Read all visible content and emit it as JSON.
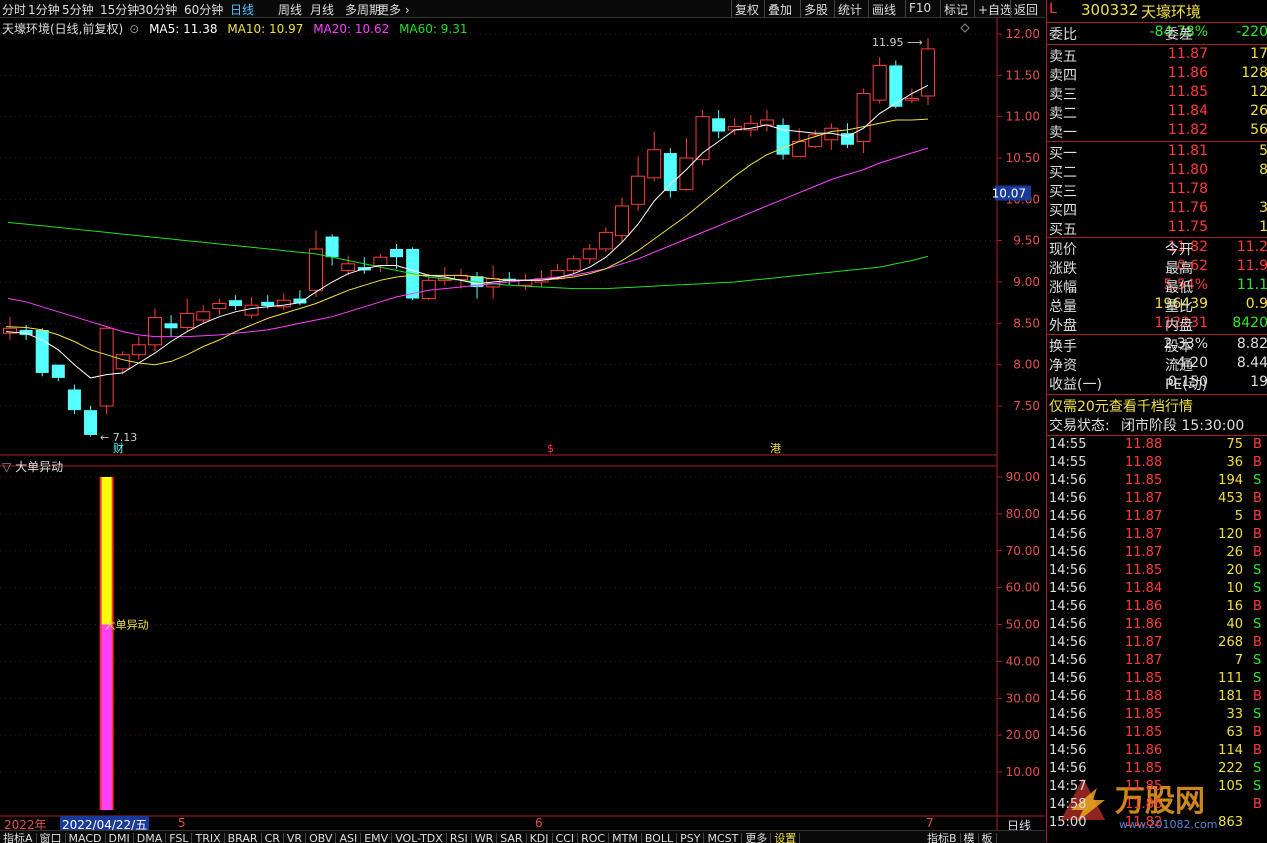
{
  "toolbar": {
    "periods": [
      "分时",
      "1分钟",
      "5分钟",
      "15分钟",
      "30分钟",
      "60分钟",
      "日线",
      "周线",
      "月线",
      "多周期",
      "更多"
    ],
    "active": "日线",
    "right_buttons": [
      "复权",
      "叠加",
      "多股",
      "统计",
      "画线",
      "F10",
      "标记",
      "+自选",
      "返回"
    ]
  },
  "main_legend": {
    "title": "天壕环境(日线,前复权)",
    "ma5": "MA5: 11.38",
    "ma10": "MA10: 10.97",
    "ma20": "MA20: 10.62",
    "ma60": "MA60: 9.31",
    "colors": {
      "ma5": "#ffffff",
      "ma10": "#f0e040",
      "ma20": "#ff40ff",
      "ma60": "#20e020"
    }
  },
  "price_axis": [
    "12.00",
    "11.50",
    "11.00",
    "10.50",
    "10.00",
    "9.50",
    "9.00",
    "8.50",
    "8.00",
    "7.50"
  ],
  "current_price_tag": "10.07",
  "annotations": {
    "high": "11.95",
    "low": "7.13",
    "cai": "财",
    "dollar": "$",
    "gang": "港"
  },
  "sub_legend": "大单异动",
  "sub_label": "大单异动",
  "sub_axis": [
    "90.00",
    "80.00",
    "70.00",
    "60.00",
    "50.00",
    "40.00",
    "30.00",
    "20.00",
    "10.00"
  ],
  "datebar": {
    "year": "2022年",
    "date": "2022/04/22/五",
    "m5": "5",
    "m6": "6",
    "m7": "7",
    "right": "日线"
  },
  "bottom_tabs": [
    "指标A",
    "窗口",
    "MACD",
    "DMI",
    "DMA",
    "FSL",
    "TRIX",
    "BRAR",
    "CR",
    "VR",
    "OBV",
    "ASI",
    "EMV",
    "VOL-TDX",
    "RSI",
    "WR",
    "SAR",
    "KDJ",
    "CCI",
    "ROC",
    "MTM",
    "BOLL",
    "PSY",
    "MCST",
    "更多",
    "设置"
  ],
  "bottom_right": [
    "指标B",
    "模",
    "板"
  ],
  "stock": {
    "flag": "L",
    "code": "300332",
    "name": "天壕环境"
  },
  "weibi": {
    "label": "委比",
    "value": "-84.78%",
    "label2": "委差",
    "value2": "-220"
  },
  "asks": [
    {
      "label": "卖五",
      "price": "11.87",
      "vol": "17"
    },
    {
      "label": "卖四",
      "price": "11.86",
      "vol": "128"
    },
    {
      "label": "卖三",
      "price": "11.85",
      "vol": "12"
    },
    {
      "label": "卖二",
      "price": "11.84",
      "vol": "26"
    },
    {
      "label": "卖一",
      "price": "11.82",
      "vol": "56"
    }
  ],
  "bids": [
    {
      "label": "买一",
      "price": "11.81",
      "vol": "5"
    },
    {
      "label": "买二",
      "price": "11.80",
      "vol": "8"
    },
    {
      "label": "买三",
      "price": "11.78",
      "vol": ""
    },
    {
      "label": "买四",
      "price": "11.76",
      "vol": "3"
    },
    {
      "label": "买五",
      "price": "11.75",
      "vol": "1"
    }
  ],
  "quote": [
    {
      "l1": "现价",
      "v1": "11.82",
      "c1": "red",
      "l2": "今开",
      "v2": "11.2",
      "c2": "red"
    },
    {
      "l1": "涨跌",
      "v1": "0.62",
      "c1": "red",
      "l2": "最高",
      "v2": "11.9",
      "c2": "red"
    },
    {
      "l1": "涨幅",
      "v1": "5.54%",
      "c1": "red",
      "l2": "最低",
      "v2": "11.1",
      "c2": "green"
    },
    {
      "l1": "总量",
      "v1": "196439",
      "c1": "yellow",
      "l2": "量比",
      "v2": "0.9",
      "c2": "yellow"
    },
    {
      "l1": "外盘",
      "v1": "112231",
      "c1": "red",
      "l2": "内盘",
      "v2": "8420",
      "c2": "green"
    }
  ],
  "fund": [
    {
      "l1": "换手",
      "v1": "2.33%",
      "l2": "股本",
      "v2": "8.82"
    },
    {
      "l1": "净资",
      "v1": "4.20",
      "l2": "流通",
      "v2": "8.44"
    },
    {
      "l1": "收益(一)",
      "v1": "0.150",
      "l2": "PE(动)",
      "v2": "19"
    }
  ],
  "promo": "仅需20元查看千档行情",
  "trade_status": {
    "label": "交易状态:",
    "value": "闭市阶段 15:30:00"
  },
  "ticks": [
    {
      "t": "14:55",
      "p": "11.88",
      "q": "75",
      "bs": "B"
    },
    {
      "t": "14:55",
      "p": "11.88",
      "q": "36",
      "bs": "B"
    },
    {
      "t": "14:56",
      "p": "11.85",
      "q": "194",
      "bs": "S"
    },
    {
      "t": "14:56",
      "p": "11.87",
      "q": "453",
      "bs": "B"
    },
    {
      "t": "14:56",
      "p": "11.87",
      "q": "5",
      "bs": "B"
    },
    {
      "t": "14:56",
      "p": "11.87",
      "q": "120",
      "bs": "B"
    },
    {
      "t": "14:56",
      "p": "11.87",
      "q": "26",
      "bs": "B"
    },
    {
      "t": "14:56",
      "p": "11.85",
      "q": "20",
      "bs": "S"
    },
    {
      "t": "14:56",
      "p": "11.84",
      "q": "10",
      "bs": "S"
    },
    {
      "t": "14:56",
      "p": "11.86",
      "q": "16",
      "bs": "B"
    },
    {
      "t": "14:56",
      "p": "11.86",
      "q": "40",
      "bs": "S"
    },
    {
      "t": "14:56",
      "p": "11.87",
      "q": "268",
      "bs": "B"
    },
    {
      "t": "14:56",
      "p": "11.87",
      "q": "7",
      "bs": "S"
    },
    {
      "t": "14:56",
      "p": "11.85",
      "q": "111",
      "bs": "S"
    },
    {
      "t": "14:56",
      "p": "11.88",
      "q": "181",
      "bs": "B"
    },
    {
      "t": "14:56",
      "p": "11.85",
      "q": "33",
      "bs": "S"
    },
    {
      "t": "14:56",
      "p": "11.85",
      "q": "63",
      "bs": "B"
    },
    {
      "t": "14:56",
      "p": "11.86",
      "q": "114",
      "bs": "B"
    },
    {
      "t": "14:56",
      "p": "11.85",
      "q": "222",
      "bs": "S"
    },
    {
      "t": "14:57",
      "p": "11.85",
      "q": "105",
      "bs": "S"
    },
    {
      "t": "14:58",
      "p": "11.86",
      "q": "",
      "bs": "B"
    },
    {
      "t": "15:00",
      "p": "11.82",
      "q": "863",
      "bs": ""
    }
  ],
  "watermark": {
    "brand": "万股网",
    "site": "www.201082.com"
  },
  "chart_data": {
    "type": "candlestick",
    "y_range": [
      7.1,
      12.2
    ],
    "candles": [
      [
        8.38,
        8.44,
        8.58,
        8.3
      ],
      [
        8.42,
        8.36,
        8.48,
        8.3
      ],
      [
        8.42,
        7.9,
        8.44,
        7.86
      ],
      [
        8.0,
        7.84,
        8.0,
        7.8
      ],
      [
        7.7,
        7.45,
        7.76,
        7.4
      ],
      [
        7.45,
        7.15,
        7.5,
        7.13
      ],
      [
        7.5,
        8.44,
        8.46,
        7.4
      ],
      [
        7.95,
        8.12,
        8.16,
        7.88
      ],
      [
        8.12,
        8.24,
        8.34,
        8.06
      ],
      [
        8.24,
        8.57,
        8.68,
        8.16
      ],
      [
        8.5,
        8.44,
        8.6,
        8.34
      ],
      [
        8.45,
        8.62,
        8.8,
        8.4
      ],
      [
        8.54,
        8.64,
        8.72,
        8.5
      ],
      [
        8.68,
        8.74,
        8.8,
        8.6
      ],
      [
        8.78,
        8.71,
        8.84,
        8.66
      ],
      [
        8.6,
        8.72,
        8.82,
        8.56
      ],
      [
        8.76,
        8.71,
        8.84,
        8.68
      ],
      [
        8.7,
        8.78,
        8.86,
        8.66
      ],
      [
        8.8,
        8.74,
        8.9,
        8.72
      ],
      [
        8.9,
        9.4,
        9.62,
        8.82
      ],
      [
        9.55,
        9.3,
        9.58,
        9.2
      ],
      [
        9.14,
        9.22,
        9.32,
        9.08
      ],
      [
        9.18,
        9.14,
        9.3,
        9.1
      ],
      [
        9.2,
        9.3,
        9.34,
        9.12
      ],
      [
        9.4,
        9.3,
        9.46,
        9.16
      ],
      [
        9.4,
        8.8,
        9.42,
        8.78
      ],
      [
        8.8,
        9.02,
        9.1,
        8.78
      ],
      [
        9.02,
        9.04,
        9.18,
        8.96
      ],
      [
        9.03,
        9.08,
        9.16,
        8.92
      ],
      [
        9.07,
        8.94,
        9.12,
        8.8
      ],
      [
        8.94,
        9.04,
        9.2,
        8.8
      ],
      [
        9.04,
        9.02,
        9.12,
        8.96
      ],
      [
        8.96,
        9.02,
        9.1,
        8.9
      ],
      [
        9.0,
        9.04,
        9.14,
        8.94
      ],
      [
        9.04,
        9.14,
        9.22,
        9.02
      ],
      [
        9.14,
        9.28,
        9.32,
        9.1
      ],
      [
        9.28,
        9.4,
        9.46,
        9.22
      ],
      [
        9.4,
        9.6,
        9.66,
        9.36
      ],
      [
        9.56,
        9.92,
        10.02,
        9.48
      ],
      [
        9.94,
        10.28,
        10.52,
        9.86
      ],
      [
        10.26,
        10.6,
        10.82,
        10.22
      ],
      [
        10.56,
        10.1,
        10.62,
        10.02
      ],
      [
        10.12,
        10.5,
        10.74,
        10.1
      ],
      [
        10.48,
        11.0,
        11.08,
        10.42
      ],
      [
        10.98,
        10.82,
        11.08,
        10.74
      ],
      [
        10.84,
        10.88,
        10.98,
        10.78
      ],
      [
        10.84,
        10.92,
        11.02,
        10.76
      ],
      [
        10.9,
        10.96,
        11.08,
        10.82
      ],
      [
        10.9,
        10.54,
        10.98,
        10.48
      ],
      [
        10.52,
        10.7,
        10.86,
        10.52
      ],
      [
        10.64,
        10.78,
        10.84,
        10.62
      ],
      [
        10.72,
        10.86,
        10.92,
        10.6
      ],
      [
        10.8,
        10.66,
        10.92,
        10.62
      ],
      [
        10.7,
        11.28,
        11.34,
        10.56
      ],
      [
        11.2,
        11.62,
        11.72,
        11.16
      ],
      [
        11.62,
        11.12,
        11.68,
        11.1
      ],
      [
        11.2,
        11.22,
        11.34,
        11.16
      ],
      [
        11.25,
        11.82,
        11.95,
        11.14
      ]
    ],
    "ma5": [
      8.4,
      8.38,
      8.3,
      8.18,
      8.0,
      7.84,
      7.88,
      7.9,
      8.02,
      8.14,
      8.28,
      8.4,
      8.5,
      8.58,
      8.64,
      8.68,
      8.7,
      8.72,
      8.75,
      8.88,
      9.0,
      9.1,
      9.16,
      9.2,
      9.2,
      9.14,
      9.08,
      9.06,
      9.02,
      8.98,
      9.0,
      9.02,
      9.02,
      9.02,
      9.05,
      9.1,
      9.18,
      9.3,
      9.48,
      9.7,
      9.98,
      10.18,
      10.36,
      10.56,
      10.7,
      10.84,
      10.86,
      10.9,
      10.84,
      10.82,
      10.8,
      10.8,
      10.76,
      10.86,
      11.04,
      11.16,
      11.28,
      11.38
    ],
    "ma10": [
      8.46,
      8.45,
      8.42,
      8.36,
      8.28,
      8.18,
      8.12,
      8.06,
      8.02,
      8.0,
      8.04,
      8.12,
      8.22,
      8.3,
      8.4,
      8.48,
      8.56,
      8.62,
      8.68,
      8.74,
      8.82,
      8.9,
      8.96,
      9.02,
      9.06,
      9.08,
      9.08,
      9.08,
      9.08,
      9.06,
      9.04,
      9.02,
      9.02,
      9.02,
      9.04,
      9.06,
      9.1,
      9.16,
      9.26,
      9.38,
      9.52,
      9.66,
      9.8,
      9.96,
      10.12,
      10.28,
      10.42,
      10.54,
      10.62,
      10.7,
      10.76,
      10.82,
      10.84,
      10.88,
      10.92,
      10.96,
      10.96,
      10.97
    ],
    "ma20": [
      8.8,
      8.76,
      8.7,
      8.64,
      8.58,
      8.52,
      8.46,
      8.4,
      8.36,
      8.34,
      8.34,
      8.34,
      8.35,
      8.36,
      8.38,
      8.4,
      8.42,
      8.46,
      8.5,
      8.54,
      8.58,
      8.64,
      8.7,
      8.76,
      8.82,
      8.86,
      8.9,
      8.92,
      8.94,
      8.96,
      8.98,
      9.0,
      9.02,
      9.04,
      9.06,
      9.08,
      9.12,
      9.16,
      9.22,
      9.28,
      9.36,
      9.44,
      9.52,
      9.6,
      9.68,
      9.76,
      9.84,
      9.92,
      10.0,
      10.08,
      10.16,
      10.24,
      10.3,
      10.36,
      10.44,
      10.5,
      10.56,
      10.62
    ],
    "ma60": [
      9.72,
      9.7,
      9.68,
      9.66,
      9.64,
      9.62,
      9.6,
      9.58,
      9.56,
      9.54,
      9.52,
      9.5,
      9.48,
      9.46,
      9.44,
      9.42,
      9.4,
      9.38,
      9.36,
      9.34,
      9.3,
      9.26,
      9.22,
      9.18,
      9.14,
      9.1,
      9.06,
      9.04,
      9.02,
      9.0,
      8.98,
      8.96,
      8.95,
      8.94,
      8.93,
      8.92,
      8.92,
      8.92,
      8.93,
      8.94,
      8.95,
      8.96,
      8.97,
      8.98,
      8.99,
      9.0,
      9.02,
      9.04,
      9.06,
      9.08,
      9.1,
      9.12,
      9.14,
      9.16,
      9.18,
      9.22,
      9.26,
      9.31
    ],
    "sub_indicator": {
      "name": "大单异动",
      "y_range": [
        0,
        95
      ],
      "bars": [
        {
          "index": 6,
          "yellow": 90,
          "magenta": 50
        }
      ]
    }
  }
}
